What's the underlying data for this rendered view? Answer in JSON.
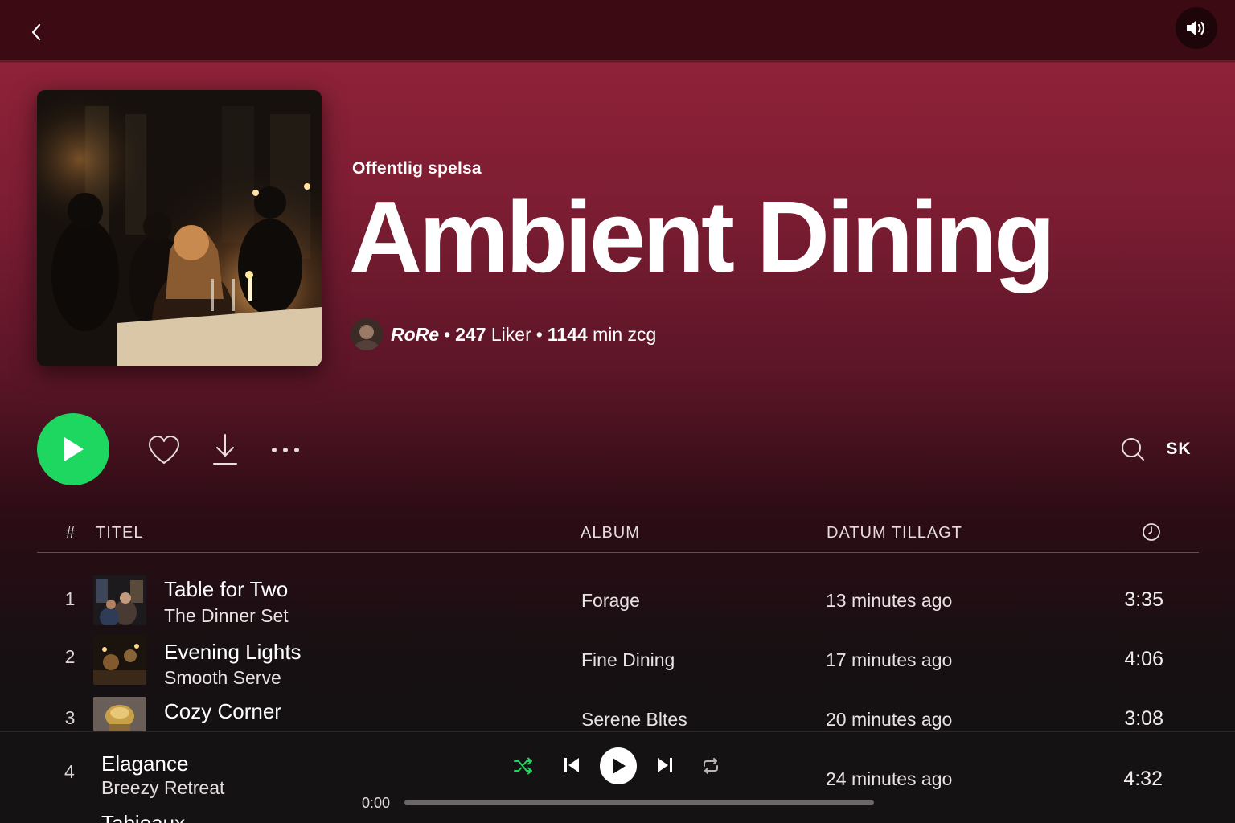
{
  "header": {
    "kind": "Offentlig spelsa",
    "title": "Ambient Dining",
    "owner": "RoRe",
    "likes_count": "247",
    "likes_label": "Liker",
    "duration_value": "1144",
    "duration_label": "min zcg",
    "separator": "•"
  },
  "actions": {
    "sort_label": "SK"
  },
  "table_header": {
    "number": "#",
    "title": "TITEL",
    "album": "ALBUM",
    "date_added": "DATUM TILLAGT",
    "duration_icon": "clock-icon"
  },
  "tracks": [
    {
      "number": "1",
      "title": "Table for Two",
      "artist": "The Dinner Set",
      "album": "Forage",
      "added": "13 minutes ago",
      "duration": "3:35"
    },
    {
      "number": "2",
      "title": "Evening Lights",
      "artist": "Smooth Serve",
      "album": "Fine Dining",
      "added": "17 minutes ago",
      "duration": "4:06"
    },
    {
      "number": "3",
      "title": "Cozy Corner",
      "artist": "",
      "album": "Serene Bltes",
      "added": "20 minutes ago",
      "duration": "3:08"
    },
    {
      "number": "4",
      "title": "Elagance",
      "artist": "Breezy Retreat",
      "album": "",
      "added": "24 minutes ago",
      "duration": "4:32"
    }
  ],
  "player": {
    "next_title": "Tabieaux",
    "elapsed": "0:00",
    "progress": 0,
    "accent_color": "#1ed760"
  },
  "icons": {
    "back": "chevron-left-icon",
    "volume": "speaker-icon",
    "play": "play-icon",
    "like": "heart-icon",
    "download": "download-icon",
    "more": "more-icon",
    "search": "search-icon",
    "shuffle": "shuffle-icon",
    "previous": "skip-back-icon",
    "next": "skip-forward-icon",
    "repeat": "repeat-icon"
  },
  "colors": {
    "header_bg": "#8e2238",
    "topbar_bg": "#3b0a12",
    "play_green": "#1ed760"
  }
}
